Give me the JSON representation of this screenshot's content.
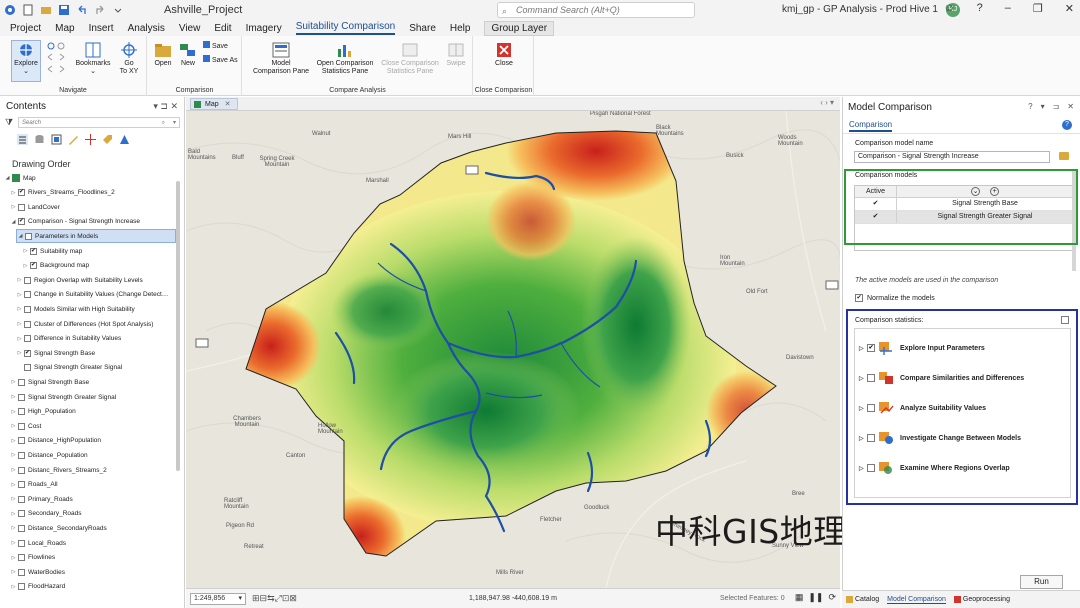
{
  "title_bar": {
    "project_name": "Ashville_Project",
    "command_search_placeholder": "Command Search (Alt+Q)",
    "window_title": "kmj_gp - GP Analysis - Prod Hive 1",
    "user_initials": "KJ"
  },
  "ribbon": {
    "tabs": [
      "Project",
      "Map",
      "Insert",
      "Analysis",
      "View",
      "Edit",
      "Imagery",
      "Suitability Comparison",
      "Share",
      "Help"
    ],
    "active_tab": "Suitability Comparison",
    "context_tab": "Group Layer",
    "navigate": {
      "explore": "Explore",
      "bookmarks": "Bookmarks",
      "go_to_xy_line1": "Go",
      "go_to_xy_line2": "To XY",
      "label": "Navigate"
    },
    "comparison": {
      "open": "Open",
      "new": "New",
      "save": "Save",
      "save_as": "Save As",
      "label": "Comparison"
    },
    "compare_analysis": {
      "model_comparison_pane_1": "Model",
      "model_comparison_pane_2": "Comparison Pane",
      "open_stats_pane_1": "Open Comparison",
      "open_stats_pane_2": "Statistics Pane",
      "close_stats_pane_1": "Close Comparison",
      "close_stats_pane_2": "Statistics Pane",
      "swipe": "Swipe",
      "label": "Compare Analysis"
    },
    "close_group": {
      "close": "Close",
      "label": "Close Comparison"
    }
  },
  "contents": {
    "title": "Contents",
    "search_placeholder": "Search",
    "drawing_order": "Drawing Order",
    "layers": [
      {
        "name": "Map",
        "indent": 0,
        "expanded": true,
        "checked": null,
        "map": true
      },
      {
        "name": "Rivers_Streams_Floodlines_2",
        "indent": 1,
        "expanded": false,
        "checked": true
      },
      {
        "name": "LandCover",
        "indent": 1,
        "expanded": false,
        "checked": false
      },
      {
        "name": "Comparison - Signal Strength Increase",
        "indent": 1,
        "expanded": true,
        "checked": true
      },
      {
        "name": "Parameters in Models",
        "indent": 2,
        "expanded": true,
        "checked": false,
        "selected": true
      },
      {
        "name": "Suitability map",
        "indent": 3,
        "expanded": false,
        "checked": true
      },
      {
        "name": "Background map",
        "indent": 3,
        "expanded": false,
        "checked": true
      },
      {
        "name": "Region Overlap with Suitability Levels",
        "indent": 2,
        "expanded": false,
        "checked": false
      },
      {
        "name": "Change in Suitability Values (Change Detect…",
        "indent": 2,
        "expanded": false,
        "checked": false
      },
      {
        "name": "Models Similar with High Suitability",
        "indent": 2,
        "expanded": false,
        "checked": false
      },
      {
        "name": "Cluster of Differences (Hot Spot Analysis)",
        "indent": 2,
        "expanded": false,
        "checked": false
      },
      {
        "name": "Difference in Suitability Values",
        "indent": 2,
        "expanded": false,
        "checked": false
      },
      {
        "name": "Signal Strength Base",
        "indent": 2,
        "expanded": false,
        "checked": true
      },
      {
        "name": "Signal Strength Greater Signal",
        "indent": 2,
        "expanded": null,
        "checked": false
      },
      {
        "name": "Signal Strength Base",
        "indent": 1,
        "expanded": false,
        "checked": false
      },
      {
        "name": "Signal Strength Greater Signal",
        "indent": 1,
        "expanded": false,
        "checked": false
      },
      {
        "name": "High_Population",
        "indent": 1,
        "expanded": false,
        "checked": false
      },
      {
        "name": "Cost",
        "indent": 1,
        "expanded": false,
        "checked": false
      },
      {
        "name": "Distance_HighPopulation",
        "indent": 1,
        "expanded": false,
        "checked": false
      },
      {
        "name": "Distance_Population",
        "indent": 1,
        "expanded": false,
        "checked": false
      },
      {
        "name": "Distanc_Rivers_Streams_2",
        "indent": 1,
        "expanded": false,
        "checked": false
      },
      {
        "name": "Roads_All",
        "indent": 1,
        "expanded": false,
        "checked": false
      },
      {
        "name": "Primary_Roads",
        "indent": 1,
        "expanded": false,
        "checked": false
      },
      {
        "name": "Secondary_Roads",
        "indent": 1,
        "expanded": false,
        "checked": false
      },
      {
        "name": "Distance_SecondaryRoads",
        "indent": 1,
        "expanded": false,
        "checked": false
      },
      {
        "name": "Local_Roads",
        "indent": 1,
        "expanded": false,
        "checked": false
      },
      {
        "name": "Flowlines",
        "indent": 1,
        "expanded": false,
        "checked": false
      },
      {
        "name": "WaterBodies",
        "indent": 1,
        "expanded": false,
        "checked": false
      },
      {
        "name": "FloodHazard",
        "indent": 1,
        "expanded": false,
        "checked": false
      }
    ]
  },
  "map": {
    "tab_label": "Map",
    "places": [
      "Walnut",
      "Mars Hill",
      "Marshall",
      "Spring Creek Mountain",
      "Bald Mountains",
      "Bluff",
      "Pisgah National Forest",
      "Black Mountains",
      "Woods Mountain",
      "Busick",
      "Iron Mountain",
      "Old Fort",
      "Davistown",
      "Chambers Mountain",
      "Hollow Mountain",
      "Canton",
      "Ratcliff Mountain",
      "Retreat",
      "Pigeon Rd",
      "Fletcher",
      "Goodluck",
      "Mills River",
      "Sunny View",
      "Bree",
      "Chimney Rock"
    ],
    "scale": "1:249,856",
    "coordinates": "1,188,947.98 -440,608.19 m",
    "selected_features": "Selected Features: 0"
  },
  "model_comparison": {
    "title": "Model Comparison",
    "tab": "Comparison",
    "model_name_label": "Comparison model name",
    "model_name_value": "Comparison - Signal Strength Increase",
    "models_label": "Comparison models",
    "active_col": "Active",
    "models": [
      {
        "active": "✔",
        "name": "Signal Strength Base"
      },
      {
        "active": "✔",
        "name": "Signal Strength Greater Signal"
      }
    ],
    "note": "The active models are used in the comparison",
    "normalize_label": "Normalize the models",
    "stats_label": "Comparison statistics:",
    "stats": [
      {
        "label": "Explore Input Parameters",
        "checked": true
      },
      {
        "label": "Compare Similarities and Differences",
        "checked": false
      },
      {
        "label": "Analyze Suitability Values",
        "checked": false
      },
      {
        "label": "Investigate Change Between Models",
        "checked": false
      },
      {
        "label": "Examine Where Regions Overlap",
        "checked": false
      }
    ],
    "run_label": "Run"
  },
  "bottom_tabs": [
    "Catalog",
    "Model Comparison",
    "Geoprocessing"
  ],
  "watermark": "中科GIS地理信息培训",
  "colors": {
    "accent": "#1d4f91",
    "green_box": "#2e9a38",
    "blue_box": "#26329e",
    "river": "#1d4fa6"
  }
}
